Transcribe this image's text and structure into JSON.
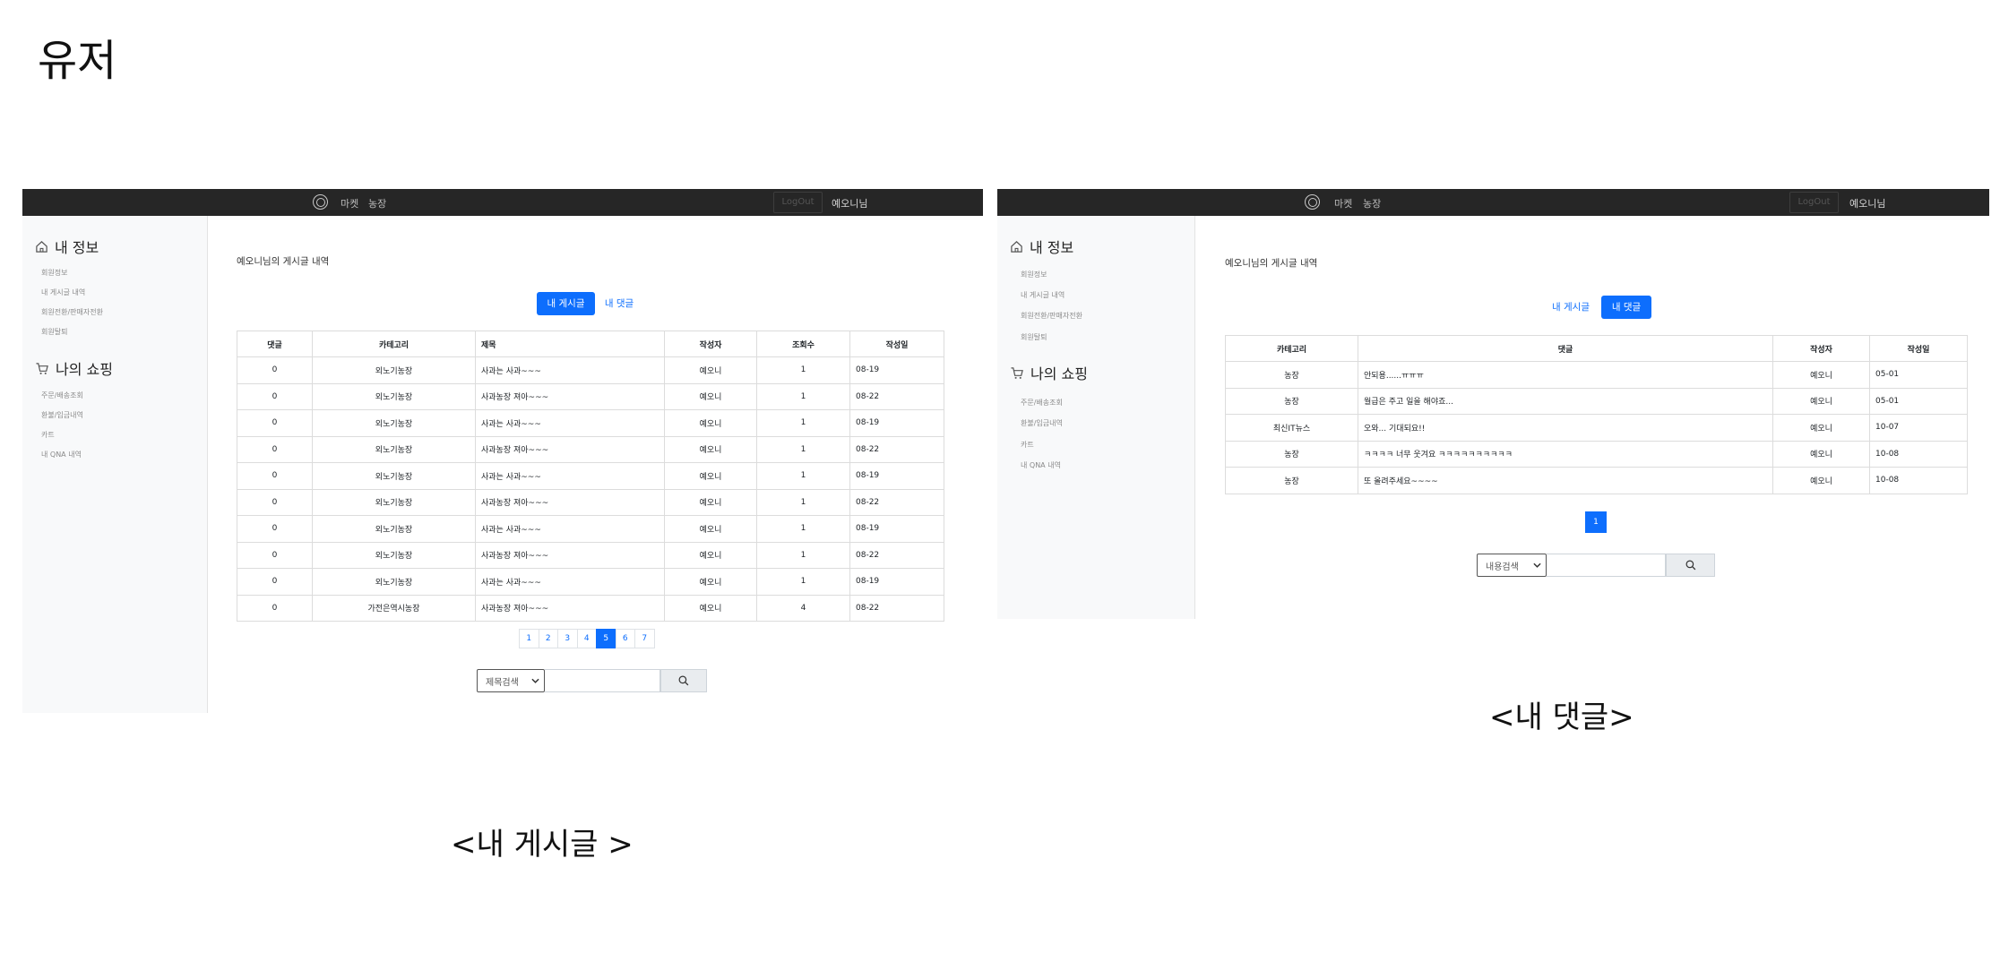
{
  "page": {
    "heading": "유저",
    "caption_posts": "<내 게시글 >",
    "caption_comments": "<내 댓글>"
  },
  "navbar": {
    "logo_icon": "aperture-icon",
    "links": [
      "마켓",
      "농장"
    ],
    "logout": "LogOut",
    "user": "예오니님"
  },
  "sidebar": {
    "info_title": "내 정보",
    "info_icon": "home-icon",
    "info_items": [
      "회원정보",
      "내 게시글 내역",
      "회원전환/판매자전환",
      "회원탈퇴"
    ],
    "shop_title": "나의 쇼핑",
    "shop_icon": "cart-icon",
    "shop_items": [
      "주문/배송조회",
      "환불/입금내역",
      "카트",
      "내 QNA 내역"
    ]
  },
  "posts_view": {
    "title": "예오니님의 게시글 내역",
    "tabs": [
      "내 게시글",
      "내 댓글"
    ],
    "active_tab": "내 게시글",
    "columns": [
      "댓글",
      "카테고리",
      "제목",
      "작성자",
      "조회수",
      "작성일"
    ],
    "rows": [
      [
        "0",
        "외노기농장",
        "사과는 사과~~~",
        "예오니",
        "1",
        "08-19"
      ],
      [
        "0",
        "외노기농장",
        "사과농장 져아~~~",
        "예오니",
        "1",
        "08-22"
      ],
      [
        "0",
        "외노기농장",
        "사과는 사과~~~",
        "예오니",
        "1",
        "08-19"
      ],
      [
        "0",
        "외노기농장",
        "사과농장 져아~~~",
        "예오니",
        "1",
        "08-22"
      ],
      [
        "0",
        "외노기농장",
        "사과는 사과~~~",
        "예오니",
        "1",
        "08-19"
      ],
      [
        "0",
        "외노기농장",
        "사과농장 져아~~~",
        "예오니",
        "1",
        "08-22"
      ],
      [
        "0",
        "외노기농장",
        "사과는 사과~~~",
        "예오니",
        "1",
        "08-19"
      ],
      [
        "0",
        "외노기농장",
        "사과농장 져아~~~",
        "예오니",
        "1",
        "08-22"
      ],
      [
        "0",
        "외노기농장",
        "사과는 사과~~~",
        "예오니",
        "1",
        "08-19"
      ],
      [
        "0",
        "가전은역시농장",
        "사과농장 져아~~~",
        "예오니",
        "4",
        "08-22"
      ]
    ],
    "pages": [
      "1",
      "2",
      "3",
      "4",
      "5",
      "6",
      "7"
    ],
    "active_page": "5",
    "search_option": "제목검색",
    "search_placeholder": ""
  },
  "comments_view": {
    "title": "예오니님의 게시글 내역",
    "tabs": [
      "내 게시글",
      "내 댓글"
    ],
    "active_tab": "내 댓글",
    "columns": [
      "카테고리",
      "댓글",
      "작성자",
      "작성일"
    ],
    "rows": [
      [
        "농장",
        "안되용......ㅠㅠㅠ",
        "예오니",
        "05-01"
      ],
      [
        "농장",
        "월급은 주고 일을 해야죠...",
        "예오니",
        "05-01"
      ],
      [
        "최신IT뉴스",
        "오와... 기대되요!!",
        "예오니",
        "10-07"
      ],
      [
        "농장",
        "ㅋㅋㅋㅋ 너무 웃겨요 ㅋㅋㅋㅋㅋㅋㅋㅋㅋㅋ",
        "예오니",
        "10-08"
      ],
      [
        "농장",
        "또 올려주세요~~~~",
        "예오니",
        "10-08"
      ]
    ],
    "pages": [
      "1"
    ],
    "active_page": "1",
    "search_option": "내용검색",
    "search_placeholder": ""
  },
  "icons": {
    "search": "search-icon",
    "dropdown": "chevron-down-icon"
  },
  "colors": {
    "primary": "#0d6efd",
    "navbar": "#262626",
    "sidebar": "#f8f9fa"
  }
}
